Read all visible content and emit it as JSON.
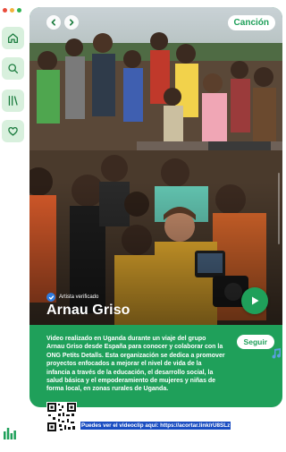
{
  "window": {
    "dots": [
      "#e94b3c",
      "#f2b33d",
      "#2fb352"
    ]
  },
  "sidebar": {
    "items": [
      {
        "icon": "home-icon"
      },
      {
        "icon": "search-icon"
      },
      {
        "icon": "library-icon"
      },
      {
        "icon": "heart-icon"
      }
    ]
  },
  "card": {
    "tag": "Canción",
    "verified_label": "Artista verificado",
    "artist": "Arnau Griso",
    "follow_label": "Seguir",
    "description": "Video realizado en Uganda durante un viaje del grupo Arnau Griso desde España para conocer y colaborar con la ONG Petits Detalls. Esta organización se dedica a promover proyectos enfocados a mejorar el nivel de vida de la infancia a través de la educación, el desarrollo social, la salud básica y el empoderamiento de mujeres y niñas de forma local, en zonas rurales de Uganda.",
    "accent_color": "#1fa05a"
  },
  "footer": {
    "link_text": "Puedes ver el videoclip aquí: https://acortar.link/rU8SLz"
  }
}
